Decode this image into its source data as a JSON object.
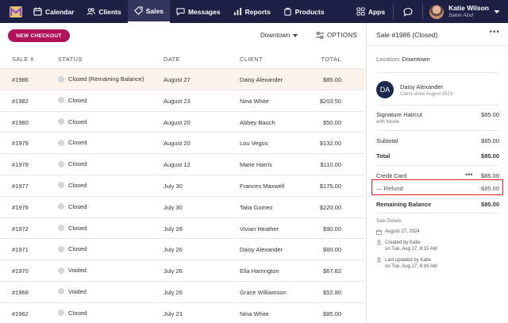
{
  "nav": {
    "items": [
      {
        "label": "Calendar",
        "icon": "calendar-icon"
      },
      {
        "label": "Clients",
        "icon": "clients-icon"
      },
      {
        "label": "Sales",
        "icon": "tag-icon"
      },
      {
        "label": "Messages",
        "icon": "messages-icon"
      },
      {
        "label": "Reports",
        "icon": "reports-icon"
      },
      {
        "label": "Products",
        "icon": "products-icon"
      }
    ],
    "apps_label": "Apps",
    "user_name": "Katie Wilson",
    "user_business": "Salon Azul"
  },
  "toolbar": {
    "new_checkout": "NEW CHECKOUT",
    "location": "Downtown",
    "options": "OPTIONS"
  },
  "table": {
    "headers": {
      "sale": "SALE #",
      "status": "STATUS",
      "date": "DATE",
      "client": "CLIENT",
      "total": "TOTAL"
    },
    "rows": [
      {
        "sale": "#1986",
        "status": "Closed (Remaining Balance)",
        "date": "August 27",
        "client": "Daisy Alexander",
        "total": "$85.00"
      },
      {
        "sale": "#1982",
        "status": "Closed",
        "date": "August 23",
        "client": "Nina White",
        "total": "$203.50"
      },
      {
        "sale": "#1980",
        "status": "Closed",
        "date": "August 20",
        "client": "Abbey Bauch",
        "total": "$50.00"
      },
      {
        "sale": "#1979",
        "status": "Closed",
        "date": "August 20",
        "client": "Lou Vegos",
        "total": "$132.00"
      },
      {
        "sale": "#1978",
        "status": "Closed",
        "date": "August 12",
        "client": "Marie Harris",
        "total": "$110.00"
      },
      {
        "sale": "#1977",
        "status": "Closed",
        "date": "July 30",
        "client": "Frances Maxwell",
        "total": "$175.00"
      },
      {
        "sale": "#1976",
        "status": "Closed",
        "date": "July 30",
        "client": "Talia Gomez",
        "total": "$220.00"
      },
      {
        "sale": "#1972",
        "status": "Closed",
        "date": "July 28",
        "client": "Vivian Heather",
        "total": "$90.00"
      },
      {
        "sale": "#1971",
        "status": "Closed",
        "date": "July 26",
        "client": "Daisy Alexander",
        "total": "$60.00"
      },
      {
        "sale": "#1970",
        "status": "Voided",
        "date": "July 26",
        "client": "Ella Harrington",
        "total": "$67.82"
      },
      {
        "sale": "#1968",
        "status": "Voided",
        "date": "July 26",
        "client": "Grace Williamson",
        "total": "$52.80"
      },
      {
        "sale": "#1962",
        "status": "Closed",
        "date": "July 23",
        "client": "Nina White",
        "total": "$85.00"
      }
    ]
  },
  "detail": {
    "title": "Sale #1986 (Closed)",
    "location_label": "Location:",
    "location_value": "Downtown",
    "client_initials": "DA",
    "client_name": "Daisy Alexander",
    "client_since": "Client since August 2023",
    "service_name": "Signature Haircut",
    "service_staff": "with Nicole",
    "service_amount": "$85.00",
    "subtotal_label": "Subtotal",
    "subtotal_amount": "$85.00",
    "total_label": "Total",
    "total_amount": "$85.00",
    "payment_label": "Credit Card",
    "payment_amount": "$85.00",
    "refund_label": "— Refund",
    "refund_amount": "-$85.00",
    "remaining_label": "Remaining Balance",
    "remaining_amount": "$85.00",
    "details_heading": "Sale Details",
    "sale_date": "August 27, 2024",
    "created_by": "Created by Katie",
    "created_on": "on Tue, Aug 27, 8:15 AM",
    "updated_by": "Last updated by Katie",
    "updated_on": "on Tue, Aug 27, 8:16 AM"
  },
  "colors": {
    "nav_bg": "#1e1f45",
    "accent": "#b0135a",
    "highlight_row": "#fdf3ea",
    "refund_outline": "#e02424"
  }
}
